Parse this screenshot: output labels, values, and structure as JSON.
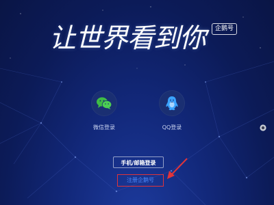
{
  "hero": {
    "slogan": "让世界看到你",
    "badge": "企鹅号"
  },
  "login_options": {
    "wechat": {
      "label": "微信登录",
      "icon": "wechat-icon",
      "color": "#3fbd45"
    },
    "qq": {
      "label": "QQ登录",
      "icon": "qq-penguin-icon",
      "color": "#3aa3ff"
    }
  },
  "actions": {
    "phone_email_login": "手机/邮箱登录",
    "register": "注册企鹅号"
  },
  "colors": {
    "background": "#0c1b58",
    "annotation": "#e0343a",
    "link": "#4d8bff"
  }
}
